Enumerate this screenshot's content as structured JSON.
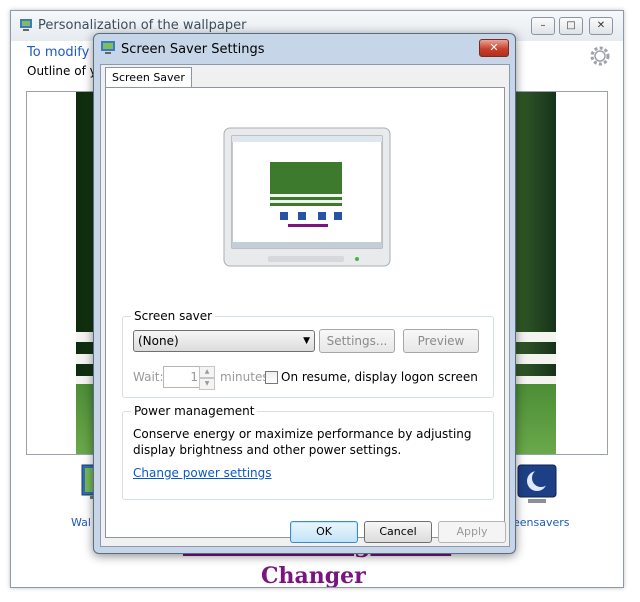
{
  "background_window": {
    "title": "Personalization of the wallpaper",
    "heading": "To modify t",
    "subtext": "Outline of yo",
    "wallpaper_label": "Wal",
    "screensavers_label": "eensavers",
    "caption_line1": "Starter Background",
    "caption_line2": "Changer",
    "buttons": {
      "minimize": "–",
      "maximize": "□",
      "close": "✕"
    }
  },
  "dialog": {
    "title": "Screen Saver Settings",
    "close_glyph": "✕",
    "tab": "Screen Saver",
    "screen_saver_group": {
      "label": "Screen saver",
      "selected": "(None)",
      "settings_button": "Settings...",
      "preview_button": "Preview",
      "wait_label": "Wait:",
      "wait_value": "1",
      "minutes_label": "minutes",
      "resume_checkbox_label": "On resume, display logon screen",
      "resume_checked": false
    },
    "power_group": {
      "label": "Power management",
      "description": "Conserve energy or maximize performance by adjusting display brightness and other power settings.",
      "link": "Change power settings"
    },
    "buttons": {
      "ok": "OK",
      "cancel": "Cancel",
      "apply": "Apply"
    }
  },
  "colors": {
    "link": "#0a58c7",
    "caption": "#7a1480",
    "heading_blue": "#1e5bbb",
    "close_red": "#c7412d"
  },
  "icons": [
    "app-icon",
    "gear-icon",
    "monitor-preview-icon",
    "wallpaper-icon",
    "screensaver-moon-icon",
    "dropdown-arrow-icon",
    "spin-up-icon",
    "spin-down-icon"
  ]
}
